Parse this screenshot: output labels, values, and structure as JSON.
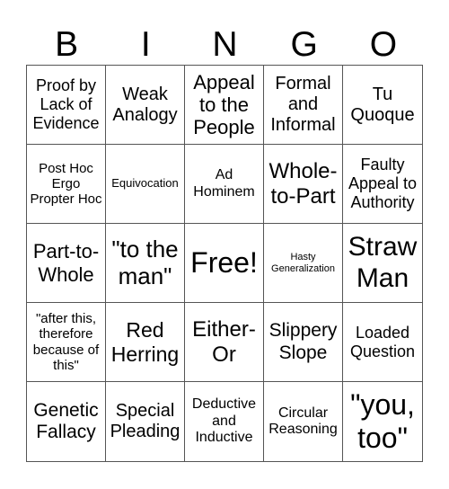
{
  "header": {
    "letters": [
      "B",
      "I",
      "N",
      "G",
      "O"
    ]
  },
  "cells": [
    "Proof by Lack of Evidence",
    "Weak Analogy",
    "Appeal to the People",
    "Formal and Informal",
    "Tu Quoque",
    "Post Hoc Ergo Propter Hoc",
    "Equivocation",
    "Ad Hominem",
    "Whole-to-Part",
    "Faulty Appeal to Authority",
    "Part-to-Whole",
    "\"to the man\"",
    "Free!",
    "Hasty Generalization",
    "Straw Man",
    "\"after this, therefore because of this\"",
    "Red Herring",
    "Either-Or",
    "Slippery Slope",
    "Loaded Question",
    "Genetic Fallacy",
    "Special Pleading",
    "Deductive and Inductive",
    "Circular Reasoning",
    "\"you, too\""
  ]
}
